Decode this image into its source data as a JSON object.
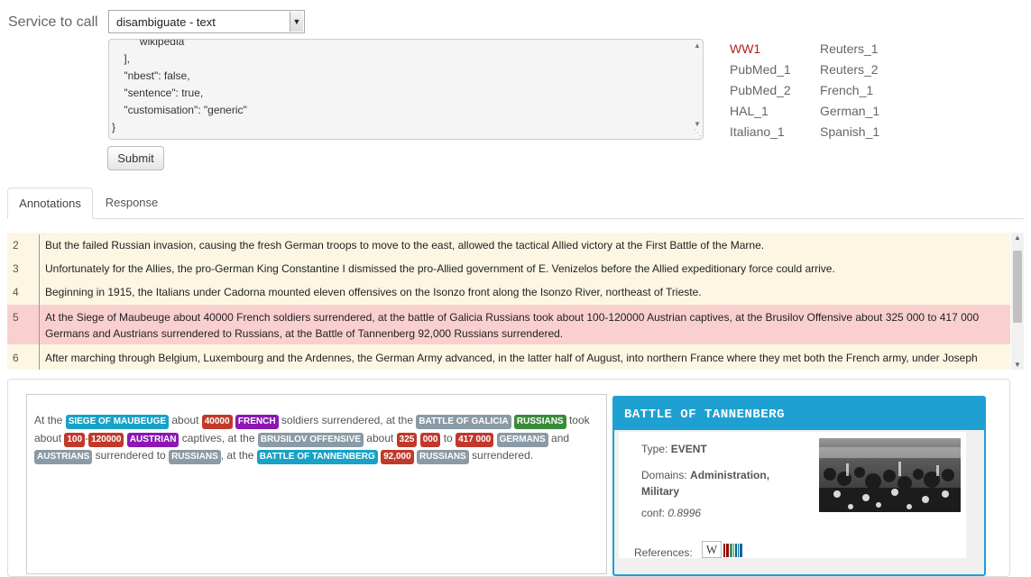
{
  "service": {
    "label": "Service to call",
    "selected": "disambiguate - text"
  },
  "query_lines": [
    "        \"wikipedia\"",
    "    ],",
    "    \"nbest\": false,",
    "    \"sentence\": true,",
    "    \"customisation\": \"generic\"",
    "}"
  ],
  "submit_label": "Submit",
  "examples": {
    "col1": [
      "WW1",
      "PubMed_1",
      "PubMed_2",
      "HAL_1",
      "Italiano_1"
    ],
    "col2": [
      "Reuters_1",
      "Reuters_2",
      "French_1",
      "German_1",
      "Spanish_1"
    ],
    "active_color": "#b22222"
  },
  "tabs": [
    "Annotations",
    "Response"
  ],
  "sentences": [
    {
      "num": "2",
      "text": "But the failed Russian invasion, causing the fresh German troops to move to the east, allowed the tactical Allied victory at the First Battle of the Marne."
    },
    {
      "num": "3",
      "text": "Unfortunately for the Allies, the pro-German King Constantine I dismissed the pro-Allied government of E. Venizelos before the Allied expeditionary force could arrive."
    },
    {
      "num": "4",
      "text": "Beginning in 1915, the Italians under Cadorna mounted eleven offensives on the Isonzo front along the Isonzo River, northeast of Trieste."
    },
    {
      "num": "5",
      "text": "At the Siege of Maubeuge about 40000 French soldiers surrendered, at the battle of Galicia Russians took about 100-120000 Austrian captives, at the Brusilov Offensive about 325 000 to 417 000 Germans and Austrians surrendered to Russians, at the Battle of Tannenberg 92,000 Russians surrendered."
    },
    {
      "num": "6",
      "text": "After marching through Belgium, Luxembourg and the Ardennes, the German Army advanced, in the latter half of August, into northern France where they met both the French army, under Joseph Joffre, and the initial six divisions of the British Expeditionary Force, under Sir John French."
    }
  ],
  "annotated": [
    {
      "t": "At the "
    },
    {
      "e": "SIEGE OF MAUBEUGE",
      "c": "loc"
    },
    {
      "t": " about "
    },
    {
      "e": "40000",
      "c": "num"
    },
    {
      "t": " "
    },
    {
      "e": "FRENCH",
      "c": "nat"
    },
    {
      "t": " soldiers surrendered, at the "
    },
    {
      "e": "BATTLE OF GALICIA",
      "c": "grey"
    },
    {
      "t": " "
    },
    {
      "e": "RUSSIANS",
      "c": "grn"
    },
    {
      "t": " took about "
    },
    {
      "e": "100",
      "c": "num"
    },
    {
      "t": "-"
    },
    {
      "e": "120000",
      "c": "num"
    },
    {
      "t": " "
    },
    {
      "e": "AUSTRIAN",
      "c": "nat"
    },
    {
      "t": " captives, at the "
    },
    {
      "e": "BRUSILOV OFFENSIVE",
      "c": "grey"
    },
    {
      "t": " about "
    },
    {
      "e": "325",
      "c": "num"
    },
    {
      "t": " "
    },
    {
      "e": "000",
      "c": "num"
    },
    {
      "t": " to "
    },
    {
      "e": "417 000",
      "c": "num"
    },
    {
      "t": " "
    },
    {
      "e": "GERMANS",
      "c": "grey"
    },
    {
      "t": " and "
    },
    {
      "e": "AUSTRIANS",
      "c": "grey"
    },
    {
      "t": " surrendered to "
    },
    {
      "e": "RUSSIANS",
      "c": "grey"
    },
    {
      "t": ", at the "
    },
    {
      "e": "BATTLE OF TANNENBERG",
      "c": "loc"
    },
    {
      "t": " "
    },
    {
      "e": "92,000",
      "c": "num"
    },
    {
      "t": " "
    },
    {
      "e": "RUSSIANS",
      "c": "grey"
    },
    {
      "t": " surrendered."
    }
  ],
  "entity_info": {
    "title": "BATTLE OF TANNENBERG",
    "type_label": "Type:",
    "type_value": "EVENT",
    "domains_label": "Domains:",
    "domains_value": "Administration,",
    "domains_value_2": "Military",
    "conf_label": "conf:",
    "conf_value": "0.8996",
    "references_label": "References:",
    "wiki_icon": "W"
  },
  "colors": {
    "location": "#17a2c6",
    "number": "#c0392b",
    "nationality": "#8b17b5",
    "neutral": "#8a9aa6",
    "person_group": "#3a8a3a",
    "highlight_row": "#f9d0cf",
    "info_header": "#1ea0d2"
  }
}
